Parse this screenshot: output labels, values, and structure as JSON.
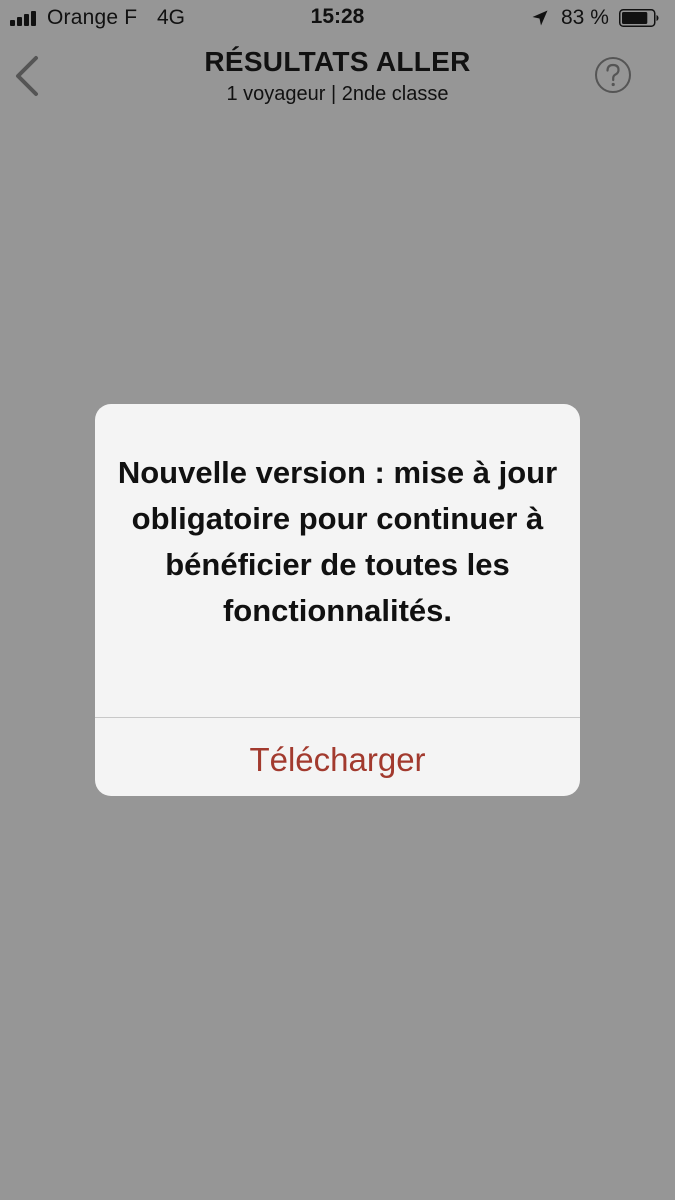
{
  "status_bar": {
    "carrier": "Orange F",
    "network": "4G",
    "time": "15:28",
    "battery_percent": "83 %",
    "battery_level": 0.83,
    "icons": [
      "signal-bars-icon",
      "location-arrow-icon",
      "battery-icon"
    ]
  },
  "header": {
    "title": "RÉSULTATS ALLER",
    "subtitle": "1 voyageur | 2nde classe",
    "back_icon": "chevron-left-icon",
    "help_icon": "question-circle-icon"
  },
  "alert": {
    "message": "Nouvelle version : mise à jour obligatoire pour continuer à bénéficier de toutes les fonctionnalités.",
    "button_label": "Télécharger"
  },
  "colors": {
    "overlay_background": "#969696",
    "alert_background": "#f4f4f4",
    "accent": "#a23a2e",
    "text": "#111111"
  }
}
